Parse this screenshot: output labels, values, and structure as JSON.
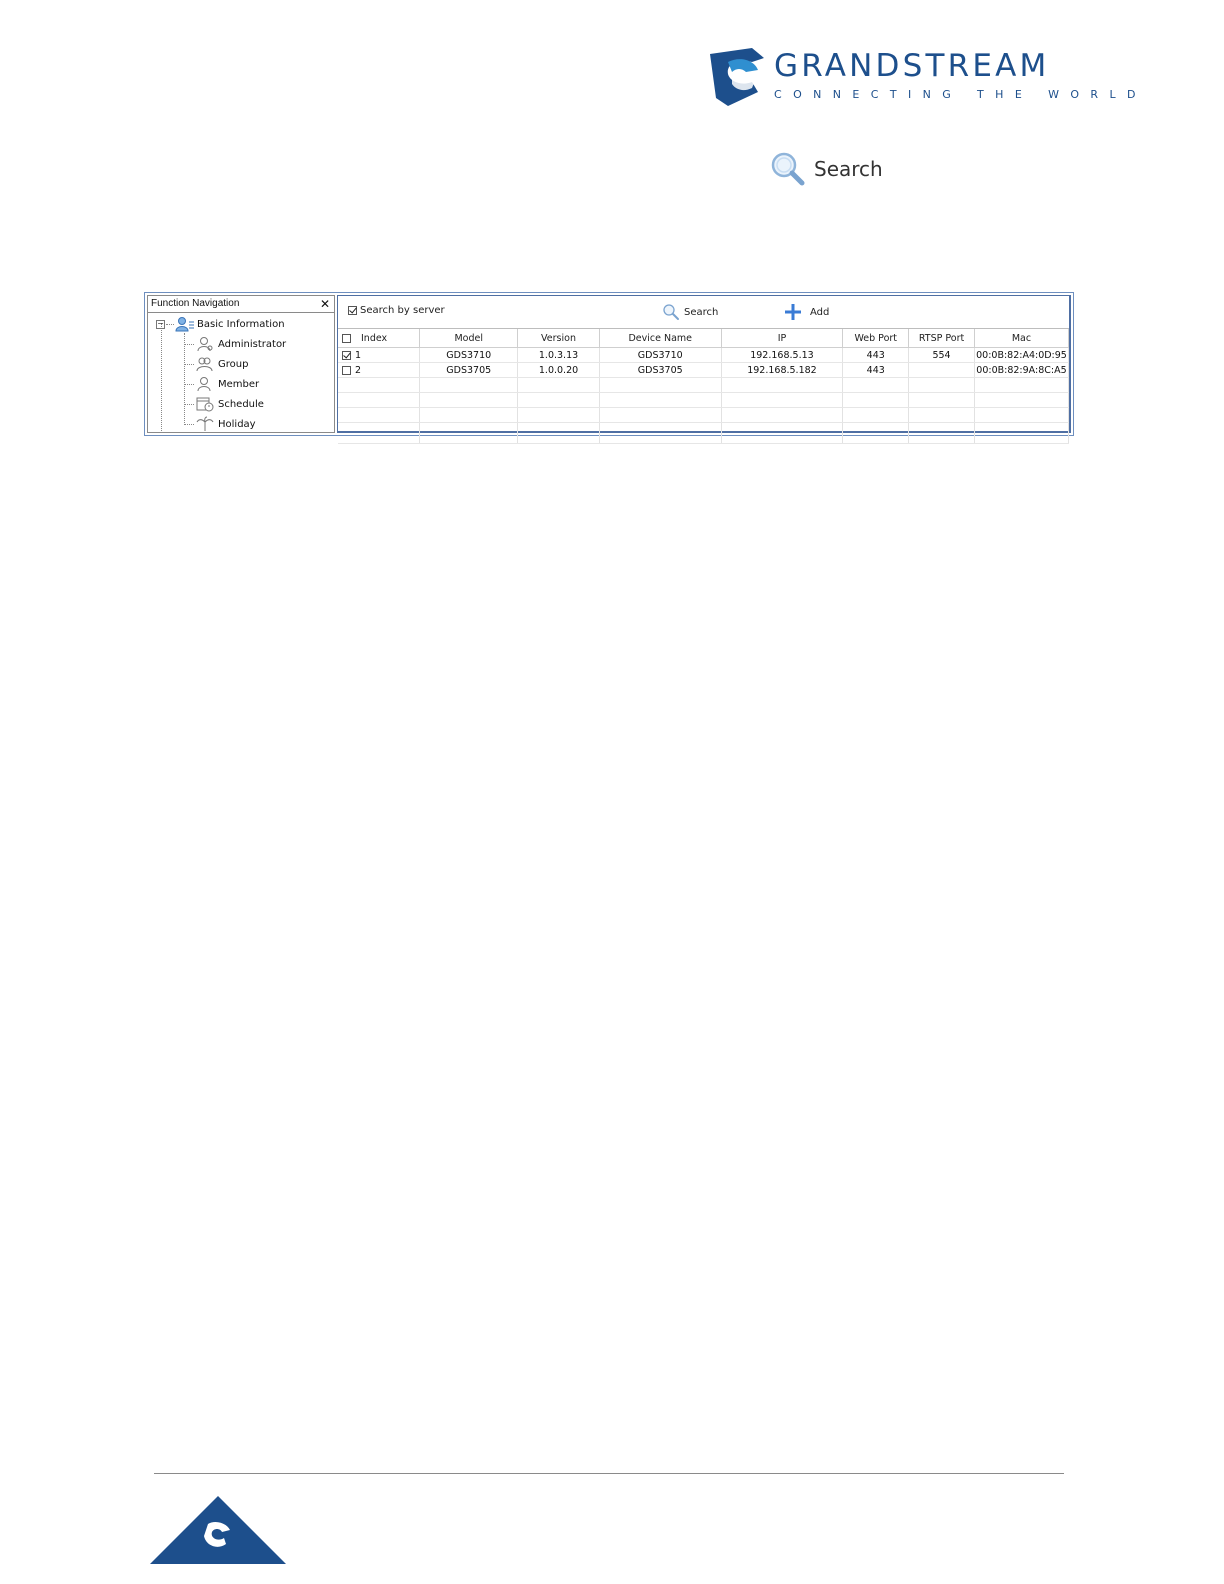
{
  "header": {
    "brand_name": "GRANDSTREAM",
    "brand_tagline": "CONNECTING THE WORLD",
    "brand_color": "#1d4f8c"
  },
  "search_button_illustration": {
    "label": "Search",
    "icon": "magnifier-icon"
  },
  "screenshot": {
    "navigation": {
      "title": "Function Navigation",
      "close_icon": "close-icon",
      "root": {
        "label": "Basic Information",
        "icon": "users-list-icon"
      },
      "items": [
        {
          "label": "Administrator",
          "icon": "admin-user-icon"
        },
        {
          "label": "Group",
          "icon": "group-icon"
        },
        {
          "label": "Member",
          "icon": "member-icon"
        },
        {
          "label": "Schedule",
          "icon": "schedule-icon"
        },
        {
          "label": "Holiday",
          "icon": "holiday-palm-icon"
        }
      ]
    },
    "toolbar": {
      "search_by_server": {
        "label": "Search by server",
        "checked": true
      },
      "search_label": "Search",
      "add_label": "Add",
      "accent_color": "#3a7bd5"
    },
    "table": {
      "columns": [
        "Index",
        "Model",
        "Version",
        "Device Name",
        "IP",
        "Web Port",
        "RTSP Port",
        "Mac"
      ],
      "rows": [
        {
          "checked": true,
          "index": "1",
          "model": "GDS3710",
          "version": "1.0.3.13",
          "device_name": "GDS3710",
          "ip": "192.168.5.13",
          "web_port": "443",
          "rtsp_port": "554",
          "mac": "00:0B:82:A4:0D:95"
        },
        {
          "checked": false,
          "index": "2",
          "model": "GDS3705",
          "version": "1.0.0.20",
          "device_name": "GDS3705",
          "ip": "192.168.5.182",
          "web_port": "443",
          "rtsp_port": "",
          "mac": "00:0B:82:9A:8C:A5"
        }
      ]
    }
  }
}
